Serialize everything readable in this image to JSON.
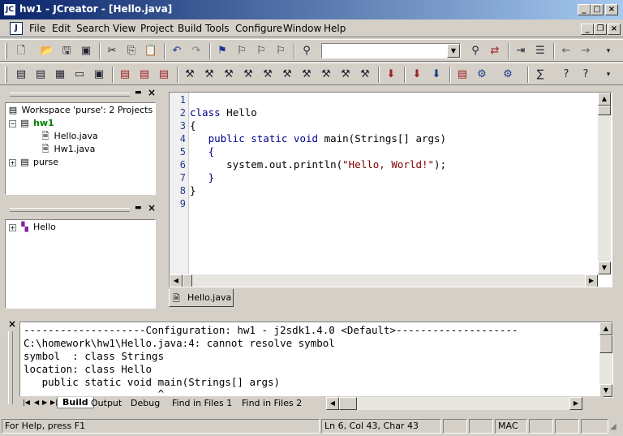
{
  "window": {
    "title": "hw1 - JCreator - [Hello.java]",
    "app_icon_text": "JC",
    "controls": {
      "minimize": "_",
      "maximize": "□",
      "close": "×"
    },
    "mdi_controls": {
      "minimize": "_",
      "restore": "❐",
      "close": "×"
    }
  },
  "menu": {
    "doc_icon_text": "J",
    "items": [
      "File",
      "Edit",
      "Search",
      "View",
      "Project",
      "Build",
      "Tools",
      "Configure",
      "Window",
      "Help"
    ]
  },
  "toolbar1": {
    "icons": [
      "new-file-icon",
      "open-icon",
      "save-icon",
      "save-all-icon",
      "cut-icon",
      "copy-icon",
      "paste-icon",
      "undo-icon",
      "redo-icon",
      "bookmark-icon",
      "next-bookmark-icon",
      "prev-bookmark-icon",
      "clear-bookmarks-icon",
      "find-icon",
      "find-in-files-icon",
      "replace-icon",
      "indent-icon",
      "outdent-icon",
      "back-icon",
      "forward-icon"
    ],
    "search_combo_value": ""
  },
  "toolbar2": {
    "icons": [
      "workspace-view-icon",
      "fileview-icon",
      "classview-icon",
      "output-view-icon",
      "fullscreen-icon",
      "new-project-icon",
      "open-project-icon",
      "project-settings-icon",
      "tool1-icon",
      "tool2-icon",
      "tool3-icon",
      "tool4-icon",
      "tool5-icon",
      "tool6-icon",
      "tool7-icon",
      "tool8-icon",
      "tool9-icon",
      "tool10-icon",
      "stop-icon",
      "compile-file-icon",
      "compile-project-icon",
      "execute-icon",
      "debug-icon",
      "debug-options-icon",
      "sdk-help-icon",
      "help-icon",
      "context-help-icon"
    ]
  },
  "workspace": {
    "root": "Workspace 'purse': 2 Projects",
    "projects": [
      {
        "name": "hw1",
        "files": [
          "Hello.java",
          "Hw1.java"
        ]
      },
      {
        "name": "purse"
      }
    ]
  },
  "classview": {
    "items": [
      "Hello"
    ]
  },
  "editor": {
    "line_numbers": [
      "1",
      "2",
      "3",
      "4",
      "5",
      "6",
      "7",
      "8",
      "9"
    ],
    "lines": {
      "l2_kw": "class",
      "l2_rest": " Hello",
      "l3": "{",
      "l4_indent": "   ",
      "l4_kw": "public static void",
      "l4_rest": " main(Strings[] args)",
      "l5": "   {",
      "l6_a": "      system.out.println(",
      "l6_str": "\"Hello, World!\"",
      "l6_b": ");",
      "l7": "   }",
      "l8": "}"
    },
    "tab_label": "Hello.java"
  },
  "output": {
    "lines": [
      "--------------------Configuration: hw1 - j2sdk1.4.0 <Default>--------------------",
      "C:\\homework\\hw1\\Hello.java:4: cannot resolve symbol",
      "symbol  : class Strings",
      "location: class Hello",
      "   public static void main(Strings[] args)",
      "                      ^"
    ],
    "tabs": [
      "Build",
      "Output",
      "Debug",
      "Find in Files 1",
      "Find in Files 2"
    ],
    "active_tab": "Build"
  },
  "statusbar": {
    "help": "For Help, press F1",
    "position": "Ln 6, Col 43, Char 43",
    "mode": "MAC"
  },
  "colors": {
    "titlebar_start": "#0a246a",
    "titlebar_end": "#a6caf0",
    "face": "#d4d0c8",
    "keyword": "#00008b",
    "string": "#800000",
    "line_number": "#1e3c8c"
  }
}
